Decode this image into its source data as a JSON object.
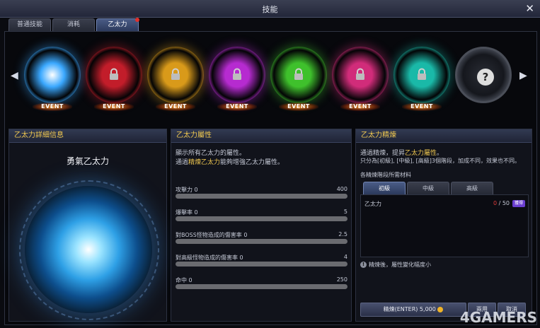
{
  "window": {
    "title": "技能"
  },
  "tabs": [
    {
      "label": "普通技能"
    },
    {
      "label": "消耗"
    },
    {
      "label": "乙太力"
    }
  ],
  "carousel": {
    "orbs": [
      {
        "color": "#3aa8ff",
        "state": "unlocked",
        "badge": "EVENT"
      },
      {
        "color": "#c21d2a",
        "state": "locked",
        "badge": "EVENT"
      },
      {
        "color": "#d99a1a",
        "state": "locked",
        "badge": "EVENT"
      },
      {
        "color": "#b62bd0",
        "state": "locked",
        "badge": "EVENT"
      },
      {
        "color": "#3fc12c",
        "state": "locked",
        "badge": "EVENT"
      },
      {
        "color": "#d12c7a",
        "state": "locked",
        "badge": "EVENT"
      },
      {
        "color": "#1ab9a8",
        "state": "locked",
        "badge": "EVENT"
      },
      {
        "color": "#555a66",
        "state": "unknown",
        "badge": "",
        "symbol": "?"
      }
    ]
  },
  "detail": {
    "header": "乙太力詳細信息",
    "name": "勇氣乙太力"
  },
  "attributes": {
    "header": "乙太力屬性",
    "desc1": "顯示所有乙太力的屬性。",
    "desc2_a": "通過",
    "desc2_hl": "精煉乙太力",
    "desc2_b": "能夠增強乙太力屬性。",
    "stats": [
      {
        "label": "攻擊力 0",
        "max": "400",
        "fill": 0
      },
      {
        "label": "爆擊率 0",
        "max": "5",
        "fill": 0
      },
      {
        "label": "對BOSS怪物造成的傷害率 0",
        "max": "2.5",
        "fill": 0
      },
      {
        "label": "對高級怪物造成的傷害率 0",
        "max": "4",
        "fill": 0
      },
      {
        "label": "命中 0",
        "max": "250",
        "fill": 0
      }
    ]
  },
  "refine": {
    "header": "乙太力精煉",
    "desc1_a": "通過精煉，提昇",
    "desc1_hl": "乙太力屬性",
    "desc1_b": "。",
    "desc2": "只分為[初級], [中級], [高級]3個階段，加成不同，效果也不同。",
    "materials_label": "各精煉階段所需材料",
    "subtabs": [
      {
        "label": "初級"
      },
      {
        "label": "中級"
      },
      {
        "label": "高級"
      }
    ],
    "material": {
      "name": "乙太力",
      "count": "0",
      "total": "/ 50",
      "tag": "獲得"
    },
    "note": "精煉後，屬性變化幅度小",
    "refine_button": "精煉(ENTER) 5,000",
    "btn2": "兩用",
    "btn3": "取消"
  },
  "watermark": "4GAMERS"
}
